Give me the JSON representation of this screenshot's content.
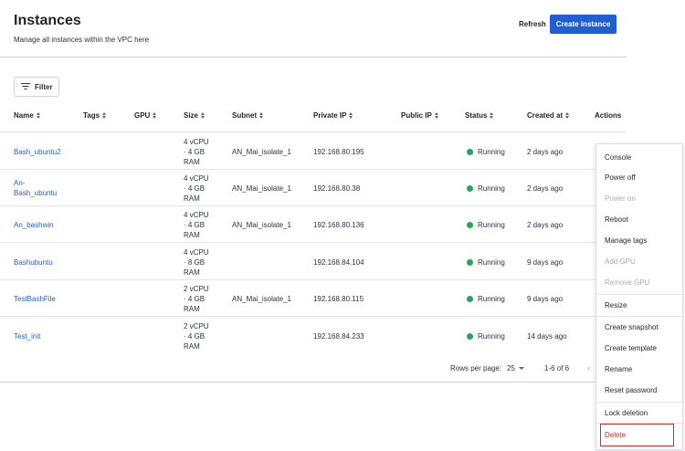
{
  "header": {
    "title": "Instances",
    "subtitle": "Manage all instances within the VPC here",
    "refresh_label": "Refresh",
    "create_label": "Create instance"
  },
  "filter": {
    "label": "Filter",
    "icon": "filter-icon"
  },
  "table": {
    "columns": [
      "Name",
      "Tags",
      "GPU",
      "Size",
      "Subnet",
      "Private IP",
      "Public IP",
      "Status",
      "Created at",
      "Actions"
    ],
    "rows": [
      {
        "name": [
          "Bash_ubuntu2"
        ],
        "size": [
          "4 vCPU",
          "· 4 GB",
          "RAM"
        ],
        "subnet": "AN_Mai_isolate_1",
        "private_ip": "192.168.80.195",
        "status": "Running",
        "created": "2 days ago"
      },
      {
        "name": [
          "An-",
          "Bash_ubuntu"
        ],
        "size": [
          "4 vCPU",
          "· 4 GB",
          "RAM"
        ],
        "subnet": "AN_Mai_isolate_1",
        "private_ip": "192.168.80.38",
        "status": "Running",
        "created": "2 days ago"
      },
      {
        "name": [
          "An_bashwin"
        ],
        "size": [
          "4 vCPU",
          "· 4 GB",
          "RAM"
        ],
        "subnet": "AN_Mai_isolate_1",
        "private_ip": "192.168.80.136",
        "status": "Running",
        "created": "2 days ago"
      },
      {
        "name": [
          "Bashubuntu"
        ],
        "size": [
          "4 vCPU",
          "· 8 GB",
          "RAM"
        ],
        "subnet": "",
        "private_ip": "192.168.84.104",
        "status": "Running",
        "created": "9 days ago"
      },
      {
        "name": [
          "TestBashFile"
        ],
        "size": [
          "2 vCPU",
          "· 4 GB",
          "RAM"
        ],
        "subnet": "AN_Mai_isolate_1",
        "private_ip": "192.168.80.115",
        "status": "Running",
        "created": "9 days ago"
      },
      {
        "name": [
          "Test_init"
        ],
        "size": [
          "2 vCPU",
          "· 4 GB",
          "RAM"
        ],
        "subnet": "",
        "private_ip": "192.168.84.233",
        "status": "Running",
        "created": "14 days ago"
      }
    ],
    "status_color": "#27a55b"
  },
  "pagination": {
    "rows_per_page_label": "Rows per page:",
    "rows_per_page_value": "25",
    "range": "1-6 of 6"
  },
  "actions_menu": {
    "items": [
      {
        "label": "Console",
        "disabled": false
      },
      {
        "label": "Power off",
        "disabled": false
      },
      {
        "label": "Power on",
        "disabled": true
      },
      {
        "label": "Reboot",
        "disabled": false
      },
      {
        "label": "Manage tags",
        "disabled": false
      },
      {
        "label": "Add GPU",
        "disabled": true
      },
      {
        "label": "Remove GPU",
        "disabled": true
      },
      {
        "label": "Resize",
        "disabled": false
      },
      {
        "label": "Create snapshot",
        "disabled": false
      },
      {
        "label": "Create template",
        "disabled": false
      },
      {
        "label": "Rename",
        "disabled": false
      },
      {
        "label": "Reset password",
        "disabled": false
      },
      {
        "label": "Lock deletion",
        "disabled": false
      },
      {
        "label": "Delete",
        "disabled": false
      }
    ],
    "highlighted": "Delete",
    "danger_color": "#d42a2a"
  },
  "colors": {
    "accent": "#1f5fd1",
    "link": "#1f5fd1"
  }
}
